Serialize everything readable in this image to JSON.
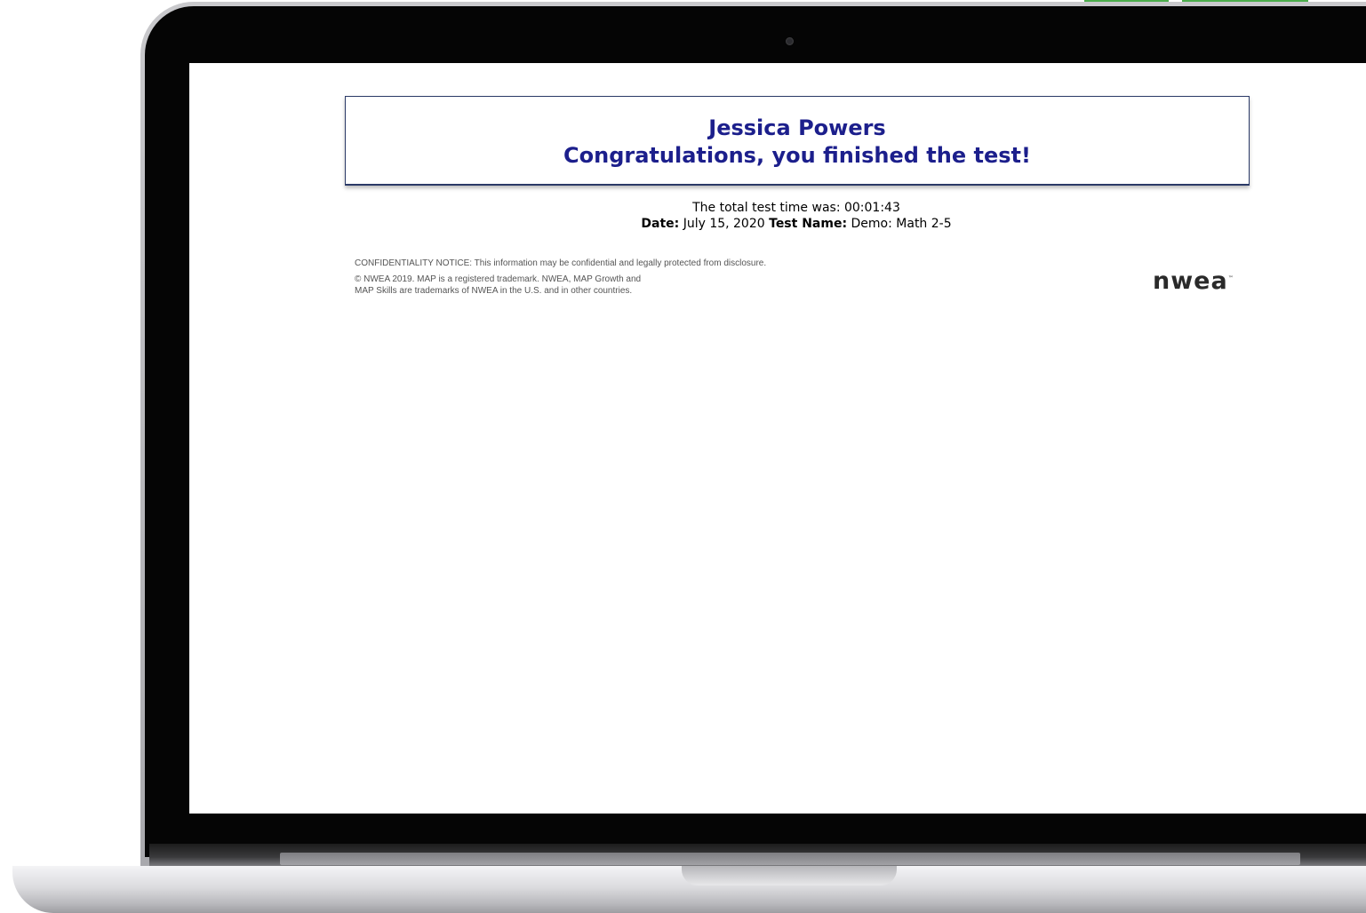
{
  "result": {
    "student_name": "Jessica Powers",
    "message": "Congratulations, you finished the test!"
  },
  "test_info": {
    "total_time_text": "The total test time was: 00:01:43",
    "date_label": "Date:",
    "date_value": "July 15, 2020",
    "test_name_label": "Test Name:",
    "test_name_value": "Demo: Math 2-5"
  },
  "footer": {
    "confidentiality": "CONFIDENTIALITY NOTICE: This information may be confidential and legally protected from disclosure.",
    "copyright_line1": "© NWEA 2019. MAP is a registered trademark. NWEA, MAP Growth and",
    "copyright_line2": "MAP Skills are trademarks of NWEA in the U.S. and in other countries."
  },
  "logo": {
    "text": "nwea",
    "tm": "™"
  },
  "colors": {
    "heading": "#1c1f8c",
    "banner_border": "#2b3a67",
    "accent_tab": "#4cae4c"
  }
}
